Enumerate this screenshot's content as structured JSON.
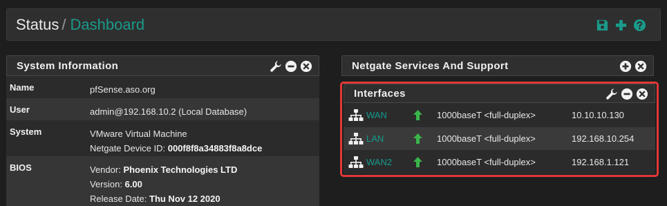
{
  "header": {
    "breadcrumb_root": "Status",
    "breadcrumb_sep": "/",
    "breadcrumb_current": "Dashboard",
    "icons": [
      "save-icon",
      "plus-icon",
      "help-icon"
    ],
    "accent_color": "#1a9a8a"
  },
  "system_info": {
    "title": "System Information",
    "rows": [
      {
        "key": "Name",
        "lines": [
          {
            "text": "pfSense.aso.org"
          }
        ]
      },
      {
        "key": "User",
        "lines": [
          {
            "text": "admin@192.168.10.2 (Local Database)"
          }
        ]
      },
      {
        "key": "System",
        "lines": [
          {
            "text": "VMware Virtual Machine"
          },
          {
            "label": "Netgate Device ID: ",
            "value": "000f8f8a34883f8a8dce"
          }
        ]
      },
      {
        "key": "BIOS",
        "lines": [
          {
            "label": "Vendor: ",
            "value": "Phoenix Technologies LTD"
          },
          {
            "label": "Version: ",
            "value": "6.00"
          },
          {
            "label": "Release Date: ",
            "value": "Thu Nov 12 2020"
          }
        ]
      }
    ]
  },
  "netgate": {
    "title": "Netgate Services And Support"
  },
  "interfaces": {
    "title": "Interfaces",
    "status_color": "#3ab54a",
    "rows": [
      {
        "name": "WAN",
        "status": "up",
        "media": "1000baseT <full-duplex>",
        "address": "10.10.10.130"
      },
      {
        "name": "LAN",
        "status": "up",
        "media": "1000baseT <full-duplex>",
        "address": "192.168.10.254"
      },
      {
        "name": "WAN2",
        "status": "up",
        "media": "1000baseT <full-duplex>",
        "address": "192.168.1.121"
      }
    ]
  }
}
